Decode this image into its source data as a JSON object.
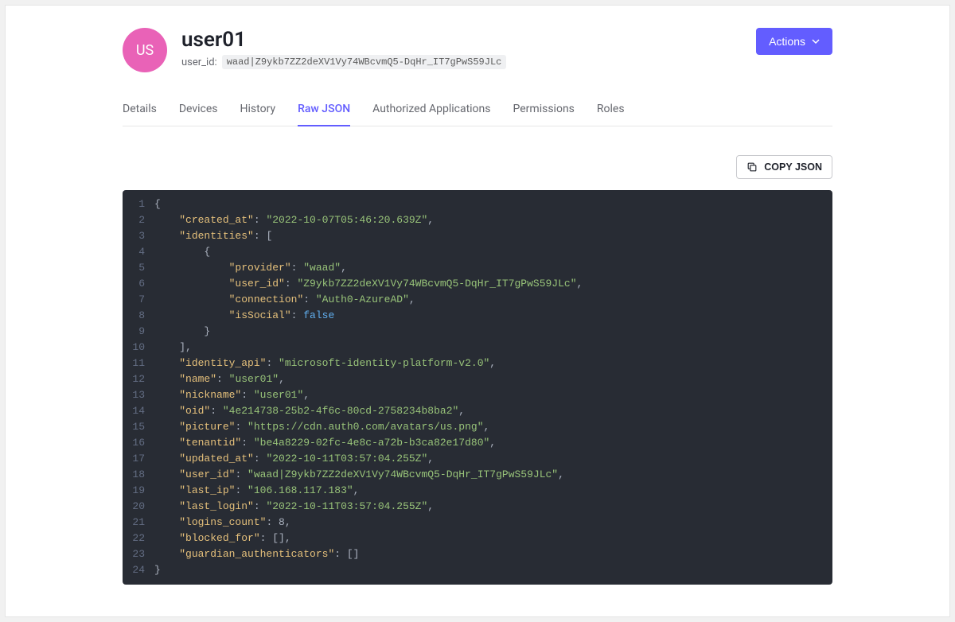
{
  "header": {
    "avatar_initials": "US",
    "title": "user01",
    "user_id_label": "user_id:",
    "user_id_value": "waad|Z9ykb7ZZ2deXV1Vy74WBcvmQ5-DqHr_IT7gPwS59JLc",
    "actions_label": "Actions"
  },
  "tabs": [
    {
      "label": "Details",
      "active": false
    },
    {
      "label": "Devices",
      "active": false
    },
    {
      "label": "History",
      "active": false
    },
    {
      "label": "Raw JSON",
      "active": true
    },
    {
      "label": "Authorized Applications",
      "active": false
    },
    {
      "label": "Permissions",
      "active": false
    },
    {
      "label": "Roles",
      "active": false
    }
  ],
  "copy_button_label": "COPY JSON",
  "code": {
    "lines": [
      [
        {
          "t": "punc",
          "v": "{"
        }
      ],
      [
        {
          "t": "ind",
          "v": "    "
        },
        {
          "t": "key",
          "v": "\"created_at\""
        },
        {
          "t": "punc",
          "v": ": "
        },
        {
          "t": "str",
          "v": "\"2022-10-07T05:46:20.639Z\""
        },
        {
          "t": "punc",
          "v": ","
        }
      ],
      [
        {
          "t": "ind",
          "v": "    "
        },
        {
          "t": "key",
          "v": "\"identities\""
        },
        {
          "t": "punc",
          "v": ": ["
        }
      ],
      [
        {
          "t": "ind",
          "v": "        "
        },
        {
          "t": "punc",
          "v": "{"
        }
      ],
      [
        {
          "t": "ind",
          "v": "            "
        },
        {
          "t": "key",
          "v": "\"provider\""
        },
        {
          "t": "punc",
          "v": ": "
        },
        {
          "t": "str",
          "v": "\"waad\""
        },
        {
          "t": "punc",
          "v": ","
        }
      ],
      [
        {
          "t": "ind",
          "v": "            "
        },
        {
          "t": "key",
          "v": "\"user_id\""
        },
        {
          "t": "punc",
          "v": ": "
        },
        {
          "t": "str",
          "v": "\"Z9ykb7ZZ2deXV1Vy74WBcvmQ5-DqHr_IT7gPwS59JLc\""
        },
        {
          "t": "punc",
          "v": ","
        }
      ],
      [
        {
          "t": "ind",
          "v": "            "
        },
        {
          "t": "key",
          "v": "\"connection\""
        },
        {
          "t": "punc",
          "v": ": "
        },
        {
          "t": "str",
          "v": "\"Auth0-AzureAD\""
        },
        {
          "t": "punc",
          "v": ","
        }
      ],
      [
        {
          "t": "ind",
          "v": "            "
        },
        {
          "t": "key",
          "v": "\"isSocial\""
        },
        {
          "t": "punc",
          "v": ": "
        },
        {
          "t": "bool",
          "v": "false"
        }
      ],
      [
        {
          "t": "ind",
          "v": "        "
        },
        {
          "t": "punc",
          "v": "}"
        }
      ],
      [
        {
          "t": "ind",
          "v": "    "
        },
        {
          "t": "punc",
          "v": "],"
        }
      ],
      [
        {
          "t": "ind",
          "v": "    "
        },
        {
          "t": "key",
          "v": "\"identity_api\""
        },
        {
          "t": "punc",
          "v": ": "
        },
        {
          "t": "str",
          "v": "\"microsoft-identity-platform-v2.0\""
        },
        {
          "t": "punc",
          "v": ","
        }
      ],
      [
        {
          "t": "ind",
          "v": "    "
        },
        {
          "t": "key",
          "v": "\"name\""
        },
        {
          "t": "punc",
          "v": ": "
        },
        {
          "t": "str",
          "v": "\"user01\""
        },
        {
          "t": "punc",
          "v": ","
        }
      ],
      [
        {
          "t": "ind",
          "v": "    "
        },
        {
          "t": "key",
          "v": "\"nickname\""
        },
        {
          "t": "punc",
          "v": ": "
        },
        {
          "t": "str",
          "v": "\"user01\""
        },
        {
          "t": "punc",
          "v": ","
        }
      ],
      [
        {
          "t": "ind",
          "v": "    "
        },
        {
          "t": "key",
          "v": "\"oid\""
        },
        {
          "t": "punc",
          "v": ": "
        },
        {
          "t": "str",
          "v": "\"4e214738-25b2-4f6c-80cd-2758234b8ba2\""
        },
        {
          "t": "punc",
          "v": ","
        }
      ],
      [
        {
          "t": "ind",
          "v": "    "
        },
        {
          "t": "key",
          "v": "\"picture\""
        },
        {
          "t": "punc",
          "v": ": "
        },
        {
          "t": "str",
          "v": "\"https://cdn.auth0.com/avatars/us.png\""
        },
        {
          "t": "punc",
          "v": ","
        }
      ],
      [
        {
          "t": "ind",
          "v": "    "
        },
        {
          "t": "key",
          "v": "\"tenantid\""
        },
        {
          "t": "punc",
          "v": ": "
        },
        {
          "t": "str",
          "v": "\"be4a8229-02fc-4e8c-a72b-b3ca82e17d80\""
        },
        {
          "t": "punc",
          "v": ","
        }
      ],
      [
        {
          "t": "ind",
          "v": "    "
        },
        {
          "t": "key",
          "v": "\"updated_at\""
        },
        {
          "t": "punc",
          "v": ": "
        },
        {
          "t": "str",
          "v": "\"2022-10-11T03:57:04.255Z\""
        },
        {
          "t": "punc",
          "v": ","
        }
      ],
      [
        {
          "t": "ind",
          "v": "    "
        },
        {
          "t": "key",
          "v": "\"user_id\""
        },
        {
          "t": "punc",
          "v": ": "
        },
        {
          "t": "str",
          "v": "\"waad|Z9ykb7ZZ2deXV1Vy74WBcvmQ5-DqHr_IT7gPwS59JLc\""
        },
        {
          "t": "punc",
          "v": ","
        }
      ],
      [
        {
          "t": "ind",
          "v": "    "
        },
        {
          "t": "key",
          "v": "\"last_ip\""
        },
        {
          "t": "punc",
          "v": ": "
        },
        {
          "t": "str",
          "v": "\"106.168.117.183\""
        },
        {
          "t": "punc",
          "v": ","
        }
      ],
      [
        {
          "t": "ind",
          "v": "    "
        },
        {
          "t": "key",
          "v": "\"last_login\""
        },
        {
          "t": "punc",
          "v": ": "
        },
        {
          "t": "str",
          "v": "\"2022-10-11T03:57:04.255Z\""
        },
        {
          "t": "punc",
          "v": ","
        }
      ],
      [
        {
          "t": "ind",
          "v": "    "
        },
        {
          "t": "key",
          "v": "\"logins_count\""
        },
        {
          "t": "punc",
          "v": ": "
        },
        {
          "t": "num",
          "v": "8"
        },
        {
          "t": "punc",
          "v": ","
        }
      ],
      [
        {
          "t": "ind",
          "v": "    "
        },
        {
          "t": "key",
          "v": "\"blocked_for\""
        },
        {
          "t": "punc",
          "v": ": [],"
        }
      ],
      [
        {
          "t": "ind",
          "v": "    "
        },
        {
          "t": "key",
          "v": "\"guardian_authenticators\""
        },
        {
          "t": "punc",
          "v": ": []"
        }
      ],
      [
        {
          "t": "punc",
          "v": "}"
        }
      ]
    ]
  }
}
